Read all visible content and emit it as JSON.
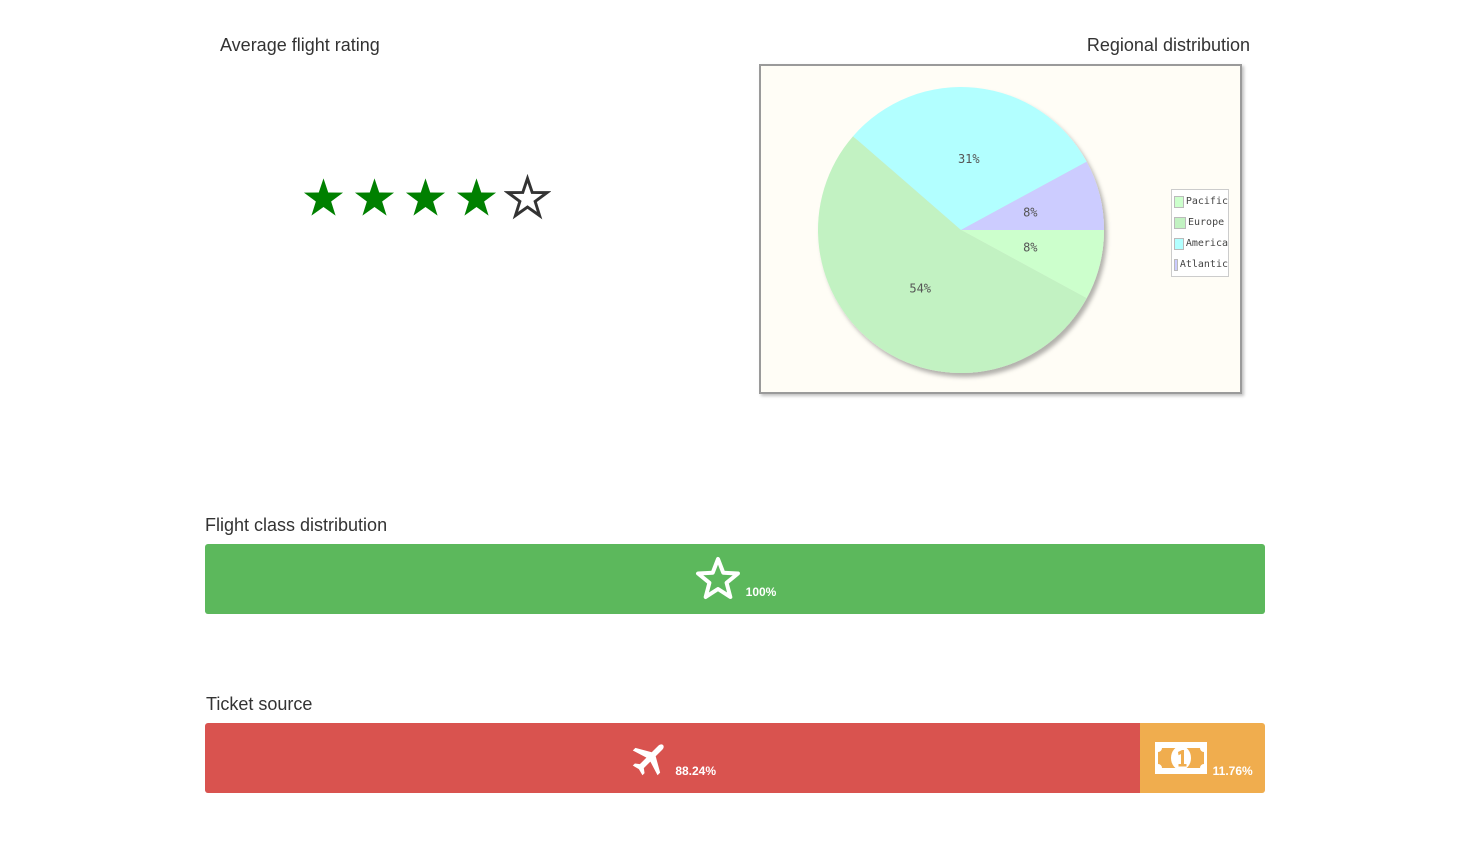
{
  "rating": {
    "title": "Average flight rating",
    "value": 4,
    "max": 5,
    "filled_color": "#008000",
    "empty_color": "#333333"
  },
  "regional": {
    "title": "Regional distribution"
  },
  "chart_data": {
    "type": "pie",
    "labels": [
      "Pacific",
      "Europe",
      "America",
      "Atlantic"
    ],
    "values": [
      8,
      54,
      31,
      8
    ],
    "value_labels": [
      "8%",
      "54%",
      "31%",
      "8%"
    ],
    "colors": [
      "#ccffcc",
      "#c2f2c2",
      "#b2ffff",
      "#ccccff"
    ],
    "legend": "right"
  },
  "flight_class": {
    "title": "Flight class distribution",
    "segments": [
      {
        "icon": "star-outline-icon",
        "label": "100%",
        "value": 100,
        "color": "#5cb85c"
      }
    ]
  },
  "ticket_source": {
    "title": "Ticket source",
    "segments": [
      {
        "icon": "airplane-icon",
        "label": "88.24%",
        "value": 88.24,
        "color": "#d9534f"
      },
      {
        "icon": "money-icon",
        "label": "11.76%",
        "value": 11.76,
        "color": "#f0ad4e"
      }
    ]
  }
}
